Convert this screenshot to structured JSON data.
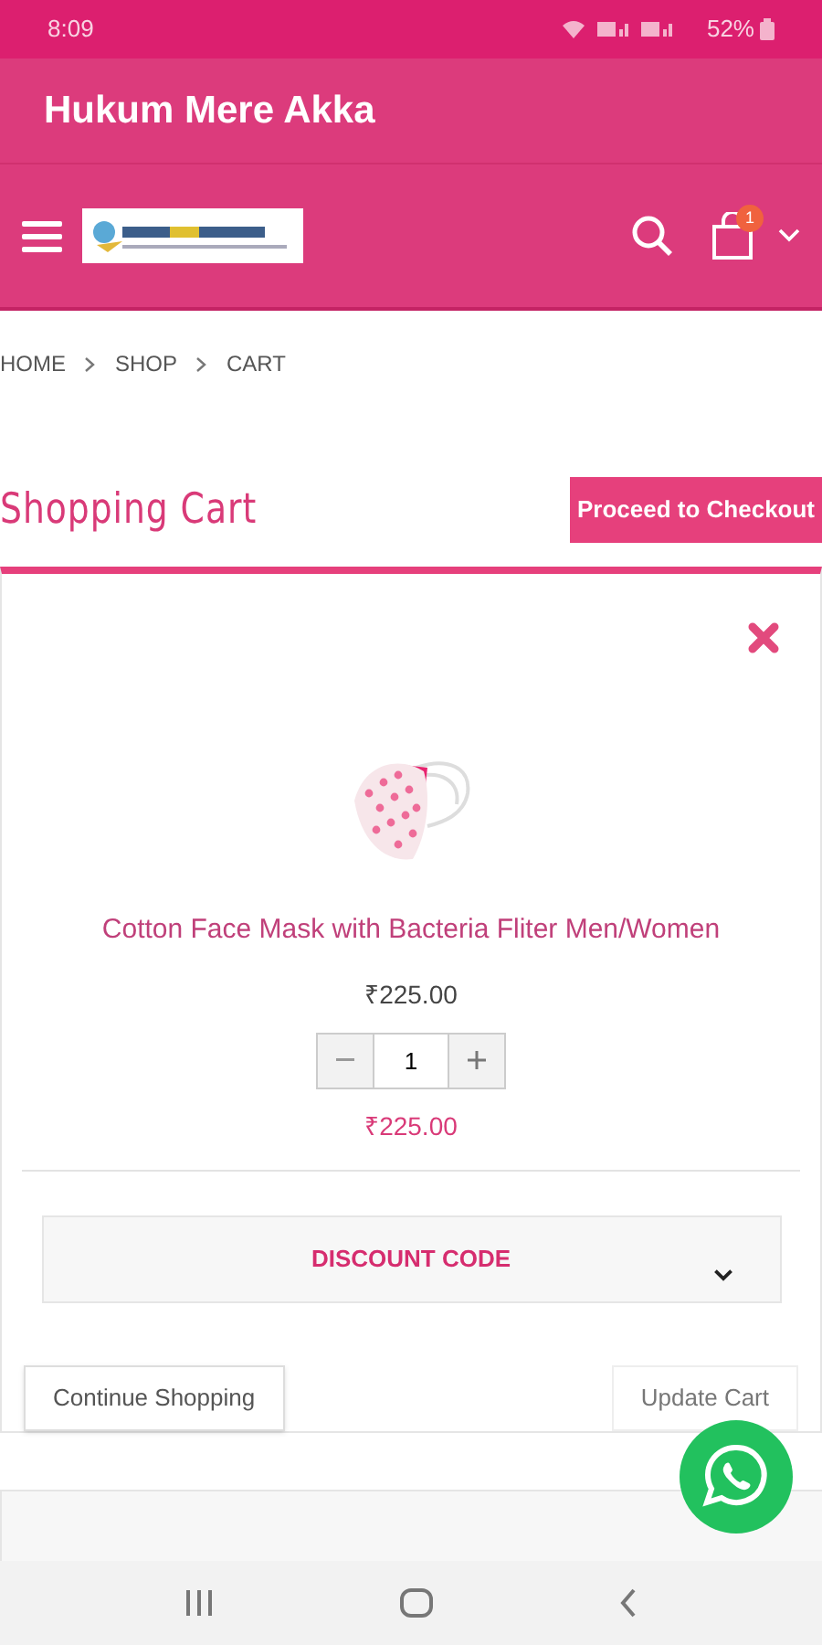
{
  "status_bar": {
    "time": "8:09",
    "battery": "52%"
  },
  "app_bar": {
    "title": "Hukum Mere Akka"
  },
  "header": {
    "cart_count": "1"
  },
  "breadcrumbs": [
    "HOME",
    "SHOP",
    "CART"
  ],
  "page_title": "Shopping Cart",
  "checkout_button": "Proceed to Checkout",
  "cart_items": [
    {
      "name": "Cotton Face Mask with Bacteria Fliter Men/Women",
      "price": "₹225.00",
      "quantity": "1",
      "subtotal": "₹225.00"
    }
  ],
  "discount": {
    "label": "DISCOUNT CODE",
    "expanded": false
  },
  "actions": [
    "Continue Shopping",
    "Update Cart"
  ]
}
